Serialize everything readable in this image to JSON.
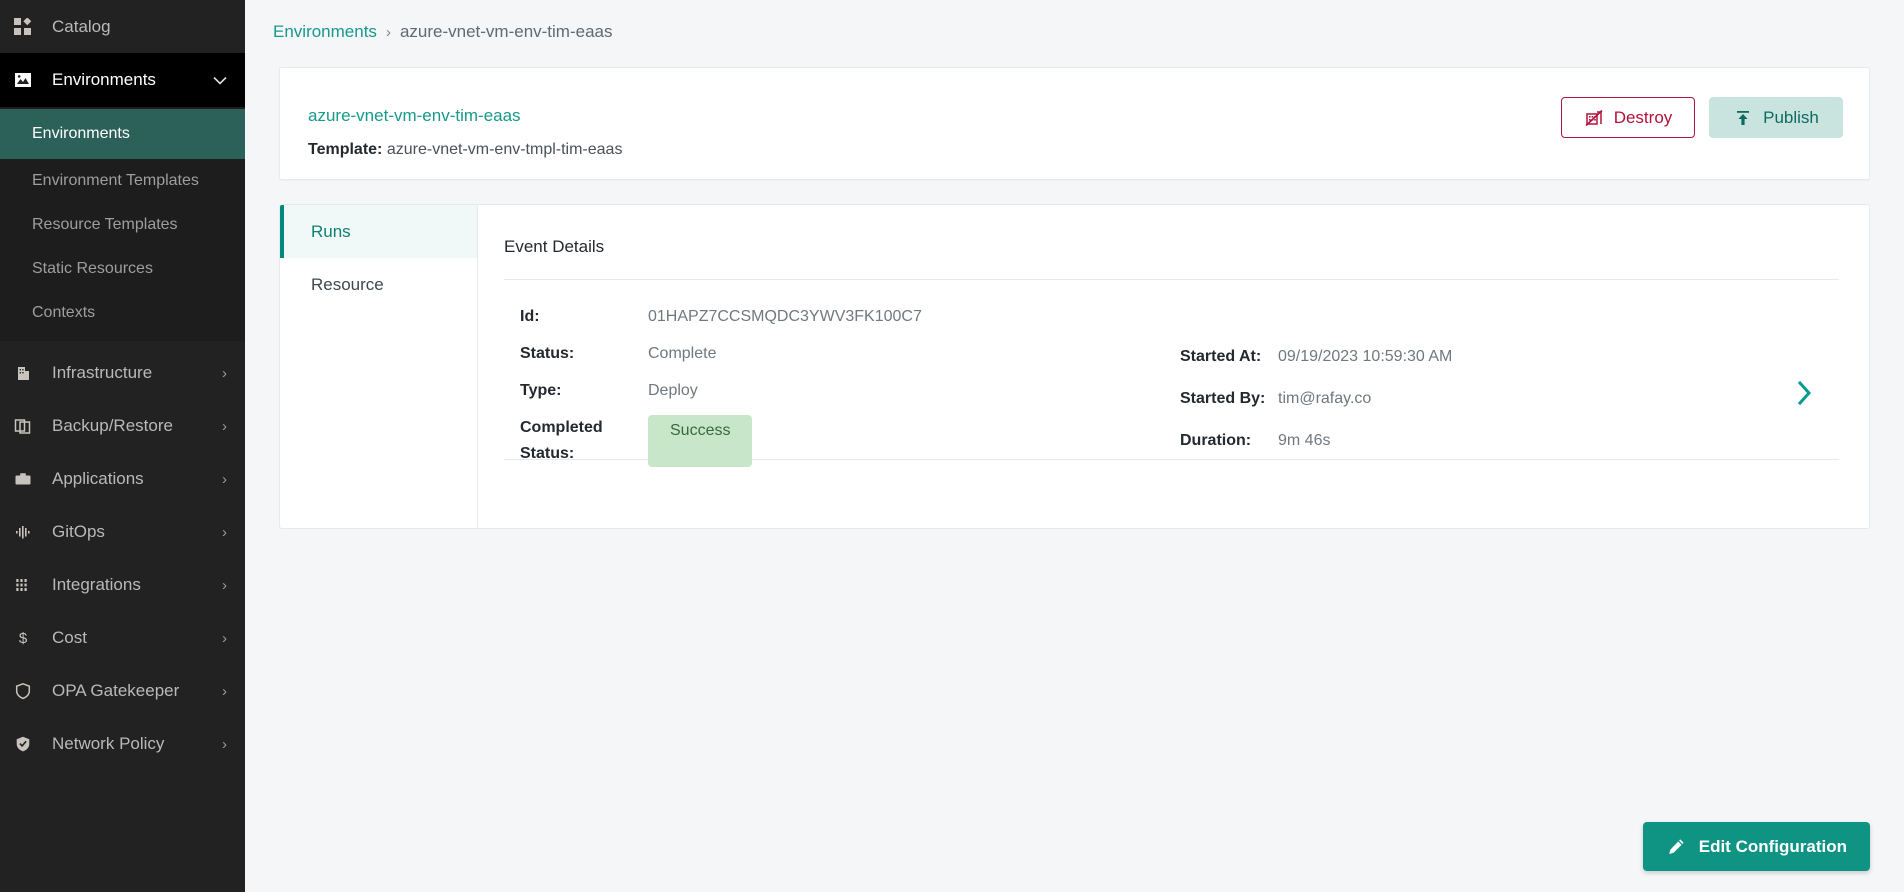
{
  "sidebar": {
    "items": [
      {
        "label": "Catalog",
        "icon": "catalog-grid-icon",
        "type": "plain"
      },
      {
        "label": "Environments",
        "icon": "environments-image-icon",
        "type": "expanded",
        "chevron": "⌄"
      }
    ],
    "sub_items": [
      {
        "label": "Environments",
        "active": true
      },
      {
        "label": "Environment Templates",
        "active": false
      },
      {
        "label": "Resource Templates",
        "active": false
      },
      {
        "label": "Static Resources",
        "active": false
      },
      {
        "label": "Contexts",
        "active": false
      }
    ],
    "bottom_items": [
      {
        "label": "Infrastructure",
        "icon": "building-icon",
        "chevron": "›"
      },
      {
        "label": "Backup/Restore",
        "icon": "copy-icon",
        "chevron": "›"
      },
      {
        "label": "Applications",
        "icon": "briefcase-icon",
        "chevron": "›"
      },
      {
        "label": "GitOps",
        "icon": "pipeline-icon",
        "chevron": "›"
      },
      {
        "label": "Integrations",
        "icon": "sliders-icon",
        "chevron": "›"
      },
      {
        "label": "Cost",
        "icon": "dollar-icon",
        "chevron": "›"
      },
      {
        "label": "OPA Gatekeeper",
        "icon": "shield-icon",
        "chevron": "›"
      },
      {
        "label": "Network Policy",
        "icon": "shield-check-icon",
        "chevron": "›"
      }
    ]
  },
  "breadcrumb": {
    "root": "Environments",
    "separator": "›",
    "current": "azure-vnet-vm-env-tim-eaas"
  },
  "env_card": {
    "name": "azure-vnet-vm-env-tim-eaas",
    "template_label": "Template:",
    "template_value": "azure-vnet-vm-env-tmpl-tim-eaas",
    "destroy_label": "Destroy",
    "publish_label": "Publish"
  },
  "panel": {
    "tabs": [
      {
        "label": "Runs",
        "active": true
      },
      {
        "label": "Resource",
        "active": false
      }
    ],
    "detail_title": "Event Details",
    "left_fields": [
      {
        "key": "Id:",
        "value": "01HAPZ7CCSMQDC3YWV3FK100C7"
      },
      {
        "key": "Status:",
        "value": "Complete"
      },
      {
        "key": "Type:",
        "value": "Deploy"
      }
    ],
    "completed_status_key": "Completed Status:",
    "completed_status_value": "Success",
    "right_fields": [
      {
        "key": "Started At:",
        "value": "09/19/2023 10:59:30 AM"
      },
      {
        "key": "Started By:",
        "value": "tim@rafay.co"
      },
      {
        "key": "Duration:",
        "value": "9m 46s"
      }
    ],
    "expand_chevron": "›"
  },
  "fab": {
    "label": "Edit Configuration",
    "icon": "pencil-icon"
  },
  "colors": {
    "accent_teal": "#0f9484",
    "link_teal": "#17998b",
    "active_nav": "#2c6159",
    "destroy_red": "#b3123b",
    "publish_bg": "#c9e4df",
    "success_bg": "#c8e6c9",
    "success_text": "#356b39",
    "sidebar_bg": "#222222"
  }
}
